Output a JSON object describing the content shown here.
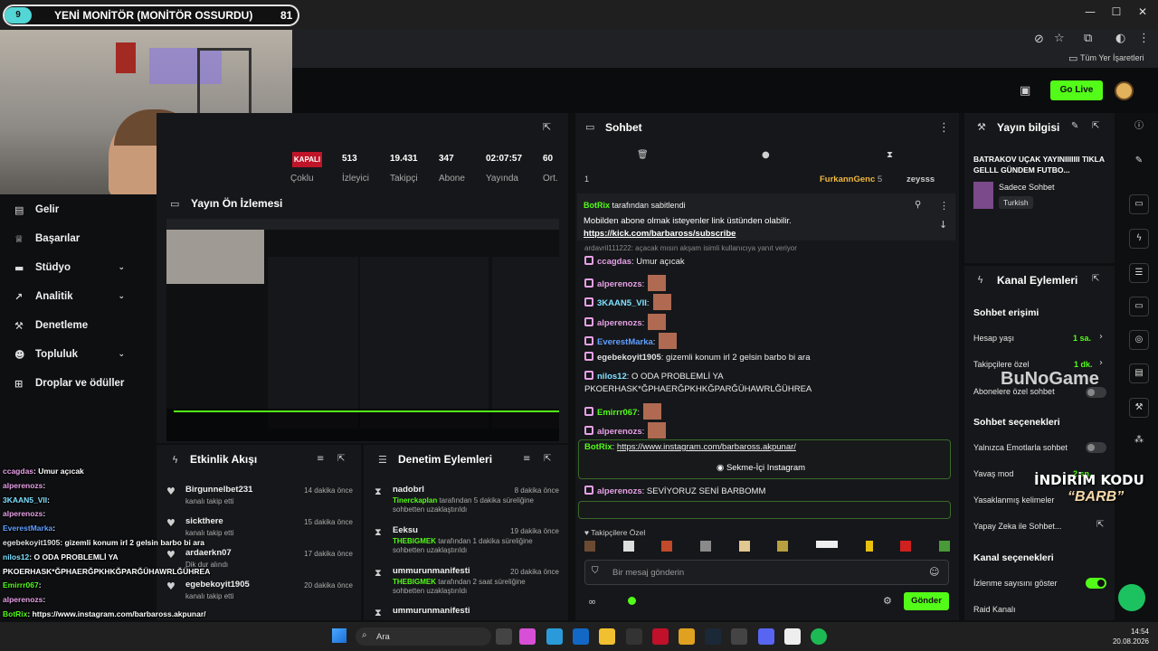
{
  "overlay": {
    "goal_count_left": "9",
    "goal_title": "YENİ MONİTÖR (MONİTÖR OSSURDU)",
    "goal_count_right": "81",
    "promo_line1": "İNDİRİM KODU",
    "promo_line2": "“BARB”",
    "watermark": "BuNoGame",
    "chat": [
      {
        "user": "ccagdas",
        "text": ": Umur açıcak",
        "color": "#e6a0e6"
      },
      {
        "user": "alperenozs",
        "text": ":",
        "color": "#e6a0e6"
      },
      {
        "user": "3KAAN5_VII",
        "text": ":",
        "color": "#7fe0ff"
      },
      {
        "user": "alperenozs",
        "text": ":",
        "color": "#e6a0e6"
      },
      {
        "user": "EverestMarka",
        "text": ":",
        "color": "#60a0ff"
      },
      {
        "user": "egebekoyit1905",
        "text": ": gizemli konum irl 2 gelsin barbo bi ara",
        "color": "#e0e0e0"
      },
      {
        "user": "nilos12",
        "text": ": O ODA PROBLEMLİ YA",
        "color": "#7fe0ff"
      },
      {
        "user": "",
        "text": "PKOERHASK*ĞPHAERĞPKHKĞPARĞÜHAWRLĞÜHREA",
        "color": "#fff"
      },
      {
        "user": "Emirrr067",
        "text": ":",
        "color": "#53fc18"
      },
      {
        "user": "alperenozs",
        "text": ":",
        "color": "#e6a0e6"
      },
      {
        "user": "BotRix",
        "text": ": https://www.instagram.com/barbaross.akpunar/",
        "color": "#53fc18"
      },
      {
        "user": "alperenozs",
        "text": ": SEVİYORUZ SENİ BARBOMM",
        "color": "#e6a0e6"
      },
      {
        "user": "Mustafa_DE1907",
        "text": ": LAN NEYE BAKIYON @Barbaross",
        "color": "#53fc18"
      }
    ]
  },
  "browser": {
    "bookmarks_label": "Tüm Yer İşaretleri",
    "window_min": "—",
    "window_max": "☐",
    "window_close": "✕"
  },
  "appbar": {
    "go_live": "Go Live"
  },
  "sidebar": {
    "items": [
      {
        "label": "Gelir",
        "icon": "▤",
        "chevron": false
      },
      {
        "label": "Başarılar",
        "icon": "♕",
        "chevron": false
      },
      {
        "label": "Stüdyo",
        "icon": "▬",
        "chevron": true
      },
      {
        "label": "Analitik",
        "icon": "↗",
        "chevron": true
      },
      {
        "label": "Denetleme",
        "icon": "⚒",
        "chevron": false
      },
      {
        "label": "Topluluk",
        "icon": "☻",
        "chevron": true
      },
      {
        "label": "Droplar ve ödüller",
        "icon": "⊞",
        "chevron": false
      }
    ]
  },
  "stats": {
    "status": "KAPALI",
    "items": [
      {
        "value": "",
        "label": "Çoklu"
      },
      {
        "value": "513",
        "label": "İzleyici"
      },
      {
        "value": "19.431",
        "label": "Takipçi"
      },
      {
        "value": "347",
        "label": "Abone"
      },
      {
        "value": "02:07:57",
        "label": "Yayında"
      },
      {
        "value": "60",
        "label": "Ort."
      }
    ]
  },
  "preview": {
    "title": "Yayın Ön İzlemesi"
  },
  "activity": {
    "title": "Etkinlik Akışı",
    "events": [
      {
        "name": "Birgunnelbet231",
        "sub": "kanalı takip etti",
        "time": "14 dakika önce"
      },
      {
        "name": "sickthere",
        "sub": "kanalı takip etti",
        "time": "15 dakika önce"
      },
      {
        "name": "ardaerkn07",
        "sub": "Dik dur alındı",
        "time": "17 dakika önce"
      },
      {
        "name": "egebekoyit1905",
        "sub": "kanalı takip etti",
        "time": "20 dakika önce"
      }
    ]
  },
  "moderation": {
    "title": "Denetim Eylemleri",
    "events": [
      {
        "name": "nadobrl",
        "actor": "Tinerckaplan",
        "sub": "tarafından 5 dakika süreliğine sohbetten uzaklaştırıldı",
        "time": "8 dakika önce"
      },
      {
        "name": "Eeksu",
        "actor": "THEBIGMEK",
        "sub": "tarafından 1 dakika süreliğine sohbetten uzaklaştırıldı",
        "time": "19 dakika önce"
      },
      {
        "name": "ummurunmanifesti",
        "actor": "THEBIGMEK",
        "sub": "tarafından 2 saat süreliğine sohbetten uzaklaştırıldı",
        "time": "20 dakika önce"
      },
      {
        "name": "ummurunmanifesti",
        "actor": "",
        "sub": "",
        "time": ""
      }
    ]
  },
  "chat": {
    "title": "Sohbet",
    "leaderboard_rank": "1",
    "top_user": "FurkannGenc",
    "top_user_count": "5",
    "second_user": "zeysss",
    "pinned_by": "BotRix",
    "pinned_by_suffix": "tarafından sabitlendi",
    "pinned_text": "Mobilden abone olmak isteyenler link üstünden olabilir.",
    "pinned_link": "https://kick.com/barbaross/subscribe",
    "reply_hint": "ardavril111222: açacak mısın akşam isimli kullanıcıya yanıt veriyor",
    "messages": [
      {
        "badge": "28",
        "user": "ccagdas",
        "color": "#e6a0e6",
        "text": ": Umur açıcak",
        "emote": false
      },
      {
        "badge": "",
        "user": "alperenozs",
        "color": "#e6a0e6",
        "text": ":",
        "emote": true
      },
      {
        "badge": "",
        "user": "3KAAN5_VII",
        "color": "#7fe0ff",
        "text": ":",
        "emote": true
      },
      {
        "badge": "",
        "user": "alperenozs",
        "color": "#e6a0e6",
        "text": ":",
        "emote": true
      },
      {
        "badge": "",
        "user": "EverestMarka",
        "color": "#60a0ff",
        "text": ":",
        "emote": true
      },
      {
        "badge": "",
        "user": "egebekoyit1905",
        "color": "#e0e0e0",
        "text": ": gizemli konum irl 2 gelsin barbo bi ara",
        "emote": false
      },
      {
        "badge": "",
        "user": "nilos12",
        "color": "#7fe0ff",
        "text": ": O ODA PROBLEMLİ YA",
        "emote": false
      },
      {
        "badge": "",
        "user": "",
        "color": "#eee",
        "text": "PKOERHASK*ĞPHAERĞPKHKĞPARĞÜHAWRLĞÜHREA",
        "emote": false
      },
      {
        "badge": "",
        "user": "Emirrr067",
        "color": "#53fc18",
        "text": ":",
        "emote": true
      },
      {
        "badge": "",
        "user": "alperenozs",
        "color": "#e6a0e6",
        "text": ":",
        "emote": true
      }
    ],
    "botrix_user": "BotRix",
    "botrix_link": "https://www.instagram.com/barbaross.akpunar/",
    "botrix_button": "Sekme-İçi Instagram",
    "after": [
      {
        "user": "alperenozs",
        "color": "#e6a0e6",
        "text": ": SEVİYORUZ SENİ BARBOMM"
      },
      {
        "user": "Mustafa_DE1907",
        "color": "#53fc18",
        "text": ": LAN NEYE BAKIYON @Barbaross"
      }
    ],
    "emote_label": "Takipçilere Özel",
    "input_placeholder": "Bir mesaj gönderin",
    "send": "Gönder"
  },
  "info": {
    "title": "Yayın bilgisi",
    "stream_title": "BATRAKOV UÇAK YAYINIIIIIII TIKLA GELLL GÜNDEM FUTBO...",
    "category": "Sadece Sohbet",
    "language": "Turkish"
  },
  "channel_actions": {
    "title": "Kanal Eylemleri",
    "chat_access": "Sohbet erişimi",
    "account_age": "Hesap yaşı",
    "account_age_val": "1 sa.",
    "followers_only": "Takipçilere özel",
    "followers_only_val": "1 dk.",
    "subs_only": "Abonelere özel sohbet",
    "chat_options": "Sohbet seçenekleri",
    "emote_only": "Yalnızca Emotlarla sohbet",
    "slow_mode": "Yavaş mod",
    "slow_mode_val": "2 sn.",
    "banned_words": "Yasaklanmış kelimeler",
    "ai_chat": "Yapay Zeka ile Sohbet...",
    "channel_options": "Kanal seçenekleri",
    "show_viewers": "İzlenme sayısını göster",
    "raid": "Raid Kanalı"
  },
  "taskbar": {
    "search": "Ara",
    "time": "14:54",
    "date": "20.08.2026"
  }
}
